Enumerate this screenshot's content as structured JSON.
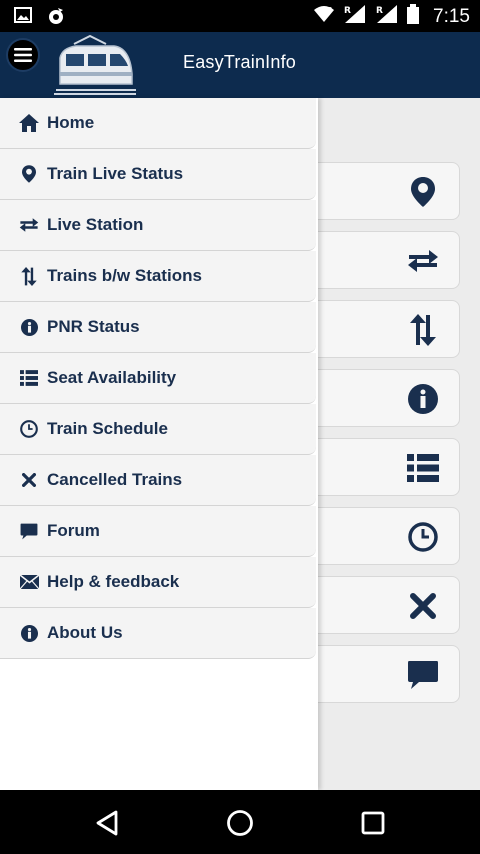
{
  "status_bar": {
    "time": "7:15",
    "icons": [
      "image-icon",
      "app-notification-icon",
      "wifi-icon",
      "signal-r-icon",
      "signal-r-icon",
      "battery-icon"
    ]
  },
  "app_bar": {
    "title": "EasyTrainInfo",
    "menu_icon": "hamburger-icon",
    "logo": "train-logo"
  },
  "drawer": {
    "items": [
      {
        "label": "Home",
        "icon": "home-icon"
      },
      {
        "label": "Train Live Status",
        "icon": "location-pin-icon"
      },
      {
        "label": "Live Station",
        "icon": "swap-horizontal-icon"
      },
      {
        "label": "Trains b/w Stations",
        "icon": "swap-vertical-icon"
      },
      {
        "label": "PNR Status",
        "icon": "info-icon"
      },
      {
        "label": "Seat Availability",
        "icon": "list-icon"
      },
      {
        "label": "Train Schedule",
        "icon": "clock-icon"
      },
      {
        "label": "Cancelled Trains",
        "icon": "close-icon"
      },
      {
        "label": "Forum",
        "icon": "chat-icon"
      },
      {
        "label": "Help & feedback",
        "icon": "mail-icon"
      },
      {
        "label": "About Us",
        "icon": "info-icon"
      }
    ]
  },
  "tiles": [
    "location-pin-icon",
    "swap-horizontal-icon",
    "swap-vertical-icon",
    "info-icon",
    "list-icon",
    "clock-icon",
    "close-icon",
    "chat-icon"
  ],
  "nav_bar": {
    "buttons": [
      "back-icon",
      "home-circle-icon",
      "recents-icon"
    ]
  },
  "colors": {
    "primary": "#0d2b4e",
    "icon": "#1a2f4e",
    "drawer_item_bg": "#f4f4f4",
    "content_bg": "#ececec"
  }
}
